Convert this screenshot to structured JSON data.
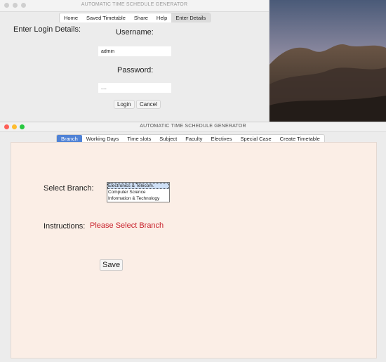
{
  "login_window": {
    "title": "AUTOMATIC TIME SCHEDULE GENERATOR",
    "tabs": [
      {
        "label": "Home"
      },
      {
        "label": "Saved Timetable"
      },
      {
        "label": "Share"
      },
      {
        "label": "Help"
      },
      {
        "label": "Enter Details",
        "active": true
      }
    ],
    "heading": "Enter Login Details:",
    "username_label": "Username:",
    "username_value": "admin",
    "password_label": "Password:",
    "password_value": "....",
    "login_button": "Login",
    "cancel_button": "Cancel"
  },
  "main_window": {
    "title": "AUTOMATIC TIME SCHEDULE GENERATOR",
    "tabs": [
      {
        "label": "Branch",
        "active": true
      },
      {
        "label": "Working Days"
      },
      {
        "label": "Time slots"
      },
      {
        "label": "Subject"
      },
      {
        "label": "Faculty"
      },
      {
        "label": "Electives"
      },
      {
        "label": "Special Case"
      },
      {
        "label": "Create Timetable"
      }
    ],
    "select_branch_label": "Select Branch:",
    "branch_options": [
      {
        "label": "Electronics & Telecom.",
        "selected": true
      },
      {
        "label": "Computer Science"
      },
      {
        "label": "Information & Technology"
      }
    ],
    "instructions_label": "Instructions:",
    "instructions_message": "Please Select Branch",
    "save_button": "Save"
  },
  "colors": {
    "traffic_close": "#fe5f57",
    "traffic_minimize": "#febc2e",
    "traffic_zoom": "#28c840",
    "active_tab": "#4f82d6",
    "panel_background": "#fbeee6",
    "instruction_text": "#c8202b"
  }
}
